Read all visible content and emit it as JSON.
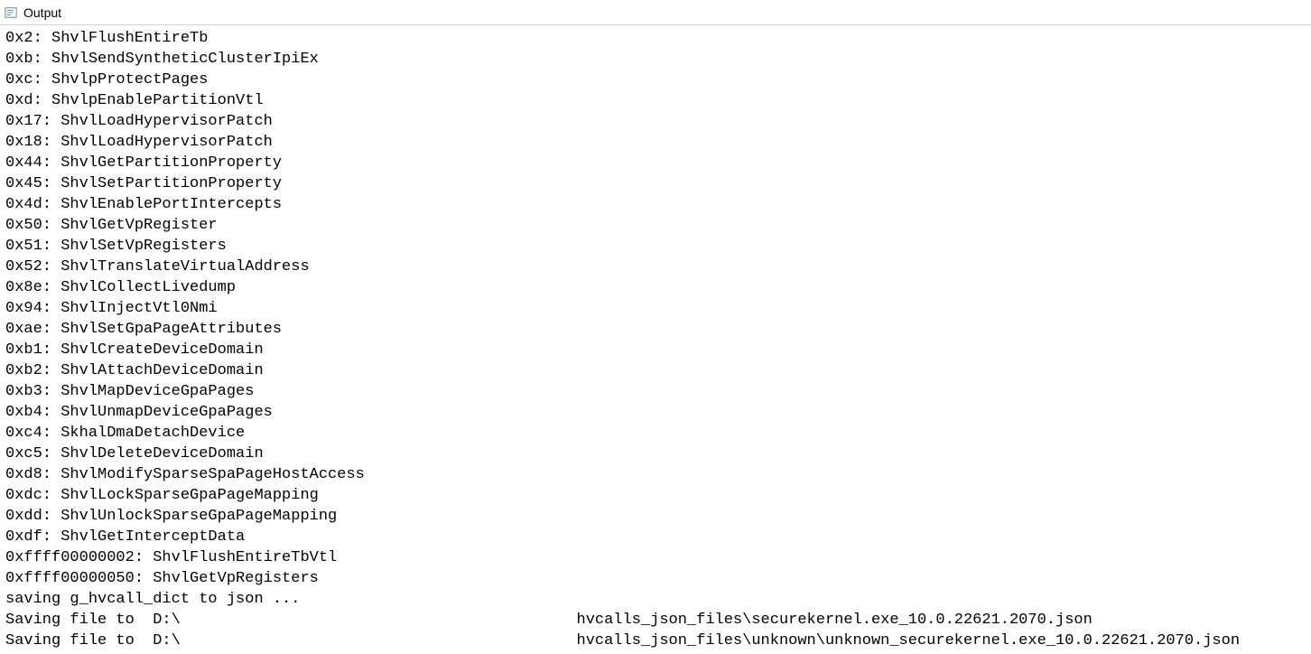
{
  "window": {
    "title": "Output"
  },
  "output": {
    "hvcalls": [
      {
        "code": "0x2",
        "name": "ShvlFlushEntireTb"
      },
      {
        "code": "0xb",
        "name": "ShvlSendSyntheticClusterIpiEx"
      },
      {
        "code": "0xc",
        "name": "ShvlpProtectPages"
      },
      {
        "code": "0xd",
        "name": "ShvlpEnablePartitionVtl"
      },
      {
        "code": "0x17",
        "name": "ShvlLoadHypervisorPatch"
      },
      {
        "code": "0x18",
        "name": "ShvlLoadHypervisorPatch"
      },
      {
        "code": "0x44",
        "name": "ShvlGetPartitionProperty"
      },
      {
        "code": "0x45",
        "name": "ShvlSetPartitionProperty"
      },
      {
        "code": "0x4d",
        "name": "ShvlEnablePortIntercepts"
      },
      {
        "code": "0x50",
        "name": "ShvlGetVpRegister"
      },
      {
        "code": "0x51",
        "name": "ShvlSetVpRegisters"
      },
      {
        "code": "0x52",
        "name": "ShvlTranslateVirtualAddress"
      },
      {
        "code": "0x8e",
        "name": "ShvlCollectLivedump"
      },
      {
        "code": "0x94",
        "name": "ShvlInjectVtl0Nmi"
      },
      {
        "code": "0xae",
        "name": "ShvlSetGpaPageAttributes"
      },
      {
        "code": "0xb1",
        "name": "ShvlCreateDeviceDomain"
      },
      {
        "code": "0xb2",
        "name": "ShvlAttachDeviceDomain"
      },
      {
        "code": "0xb3",
        "name": "ShvlMapDeviceGpaPages"
      },
      {
        "code": "0xb4",
        "name": "ShvlUnmapDeviceGpaPages"
      },
      {
        "code": "0xc4",
        "name": "SkhalDmaDetachDevice"
      },
      {
        "code": "0xc5",
        "name": "ShvlDeleteDeviceDomain"
      },
      {
        "code": "0xd8",
        "name": "ShvlModifySparseSpaPageHostAccess"
      },
      {
        "code": "0xdc",
        "name": "ShvlLockSparseGpaPageMapping"
      },
      {
        "code": "0xdd",
        "name": "ShvlUnlockSparseGpaPageMapping"
      },
      {
        "code": "0xdf",
        "name": "ShvlGetInterceptData"
      },
      {
        "code": "0xffff00000002",
        "name": "ShvlFlushEntireTbVtl"
      },
      {
        "code": "0xffff00000050",
        "name": "ShvlGetVpRegisters"
      }
    ],
    "tail_lines": [
      "saving g_hvcall_dict to json ...",
      "Saving file to  D:\\                                           hvcalls_json_files\\securekernel.exe_10.0.22621.2070.json",
      "Saving file to  D:\\                                           hvcalls_json_files\\unknown\\unknown_securekernel.exe_10.0.22621.2070.json"
    ]
  }
}
